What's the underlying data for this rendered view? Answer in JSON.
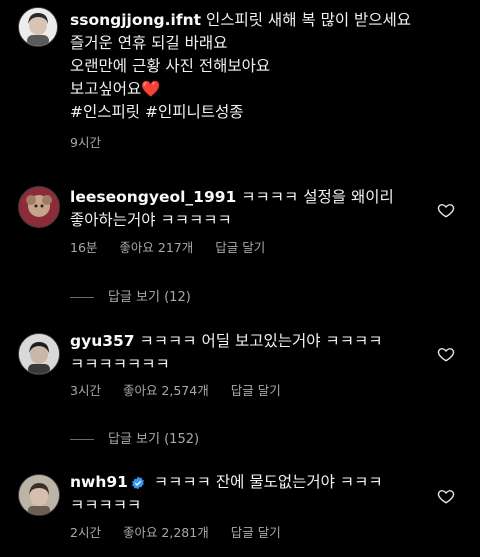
{
  "post": {
    "username": "ssongjjong.ifnt",
    "caption": "인스피릿 새해 복 많이 받으세요\n즐거운 연휴 되길 바래요\n오랜만에 근황 사진 전해보아요\n보고싶어요",
    "heart_emoji": "❤️",
    "hashtags": "#인스피릿 #인피니트성종",
    "time": "9시간"
  },
  "comments": [
    {
      "username": "leeseongyeol_1991",
      "text": "ㅋㅋㅋㅋ 설정을 왜이리\n좋아하는거야 ㅋㅋㅋㅋㅋ",
      "time": "16분",
      "likes": "좋아요 217개",
      "reply": "답글 달기",
      "view_replies": "답글 보기 (12)"
    },
    {
      "username": "gyu357",
      "text": "ㅋㅋㅋㅋ 어딜 보고있는거야 ㅋㅋㅋㅋ\nㅋㅋㅋㅋㅋㅋㅋ",
      "time": "3시간",
      "likes": "좋아요 2,574개",
      "reply": "답글 달기",
      "view_replies": "답글 보기 (152)"
    },
    {
      "username": "nwh91",
      "verified": true,
      "text": "ㅋㅋㅋㅋ 잔에 물도없는거야 ㅋㅋㅋ\nㅋㅋㅋㅋㅋ",
      "time": "2시간",
      "likes": "좋아요 2,281개",
      "reply": "답글 달기"
    }
  ],
  "colors": {
    "background": "#000000",
    "text": "#f5f5f5",
    "muted": "#a8a8a8",
    "verified": "#3897f0",
    "heart": "#e0453f"
  }
}
